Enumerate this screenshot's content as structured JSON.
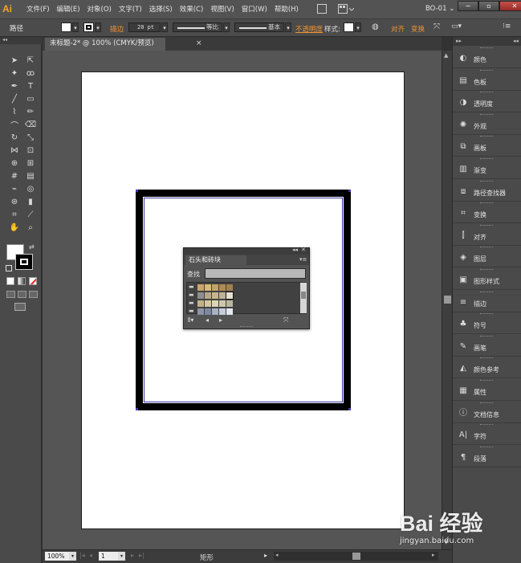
{
  "app": {
    "logo": "Ai",
    "workspace": "BO-01",
    "workspace_arrow": "⌄"
  },
  "menu": [
    "文件(F)",
    "编辑(E)",
    "对象(O)",
    "文字(T)",
    "选择(S)",
    "效果(C)",
    "视图(V)",
    "窗口(W)",
    "帮助(H)"
  ],
  "window_controls": {
    "minimize": "−",
    "maximize": "▫",
    "close": "✕"
  },
  "control_bar": {
    "selection_type": "路径",
    "stroke_label": "描边",
    "stroke_weight": "20 pt",
    "profile_1": "等比",
    "profile_2": "基本",
    "opacity_label": "不透明度",
    "style_label": "样式:",
    "align_label": "对齐",
    "transform_label": "变换"
  },
  "document": {
    "tab_title": "未标题-2* @ 100% (CMYK/预览)",
    "close_glyph": "×"
  },
  "status_bar": {
    "zoom": "100%",
    "page": "1",
    "status_text": "矩形"
  },
  "dock_panels": [
    {
      "icon": "color-icon",
      "glyph": "◐",
      "label": "颜色"
    },
    {
      "icon": "color-guide-icon",
      "glyph": "▤",
      "label": "色板"
    },
    {
      "icon": "transparency-icon",
      "glyph": "◑",
      "label": "透明度"
    },
    {
      "icon": "appearance-icon",
      "glyph": "✺",
      "label": "外观"
    },
    {
      "icon": "artboards-icon",
      "glyph": "⧉",
      "label": "画板"
    },
    {
      "icon": "gradient-icon",
      "glyph": "▥",
      "label": "渐变"
    },
    {
      "icon": "pathfinder-icon",
      "glyph": "⧈",
      "label": "路径查找器"
    },
    {
      "icon": "transform-icon",
      "glyph": "⌗",
      "label": "变换"
    },
    {
      "icon": "align-icon",
      "glyph": "⫿",
      "label": "对齐"
    },
    {
      "icon": "layers-icon",
      "glyph": "◈",
      "label": "图层"
    },
    {
      "icon": "graphic-styles-icon",
      "glyph": "▣",
      "label": "图形样式"
    },
    {
      "icon": "stroke-icon",
      "glyph": "≡",
      "label": "描边"
    },
    {
      "icon": "symbols-icon",
      "glyph": "♣",
      "label": "符号"
    },
    {
      "icon": "brushes-icon",
      "glyph": "✎",
      "label": "画笔"
    },
    {
      "icon": "color-reference-icon",
      "glyph": "◭",
      "label": "颜色参考"
    },
    {
      "icon": "attributes-icon",
      "glyph": "▦",
      "label": "属性"
    },
    {
      "icon": "document-info-icon",
      "glyph": "ⓘ",
      "label": "文档信息"
    },
    {
      "icon": "character-icon",
      "glyph": "A|",
      "label": "字符"
    },
    {
      "icon": "paragraph-icon",
      "glyph": "¶",
      "label": "段落"
    }
  ],
  "floating_panel": {
    "tab": "石头和砖块",
    "find_label": "查找",
    "find_value": "",
    "swatch_rows": [
      [
        "#c9a46b",
        "#d8b97a",
        "#c3a26c",
        "#b08a55",
        "#a1804e"
      ],
      [
        "#8e8e8e",
        "#b9a78c",
        "#c6b48f",
        "#bfb19a",
        "#e6e1d2"
      ],
      [
        "#c2b288",
        "#d6c8a2",
        "#dcd4b6",
        "#cfc7ac",
        "#b9b59f"
      ],
      [
        "#8c95a6",
        "#7c8aa0",
        "#a8b2c2",
        "#c6cedb",
        "#e3e7ee"
      ]
    ]
  },
  "watermark": {
    "logo": "Bai 经验",
    "url": "jingyan.baidu.com"
  }
}
